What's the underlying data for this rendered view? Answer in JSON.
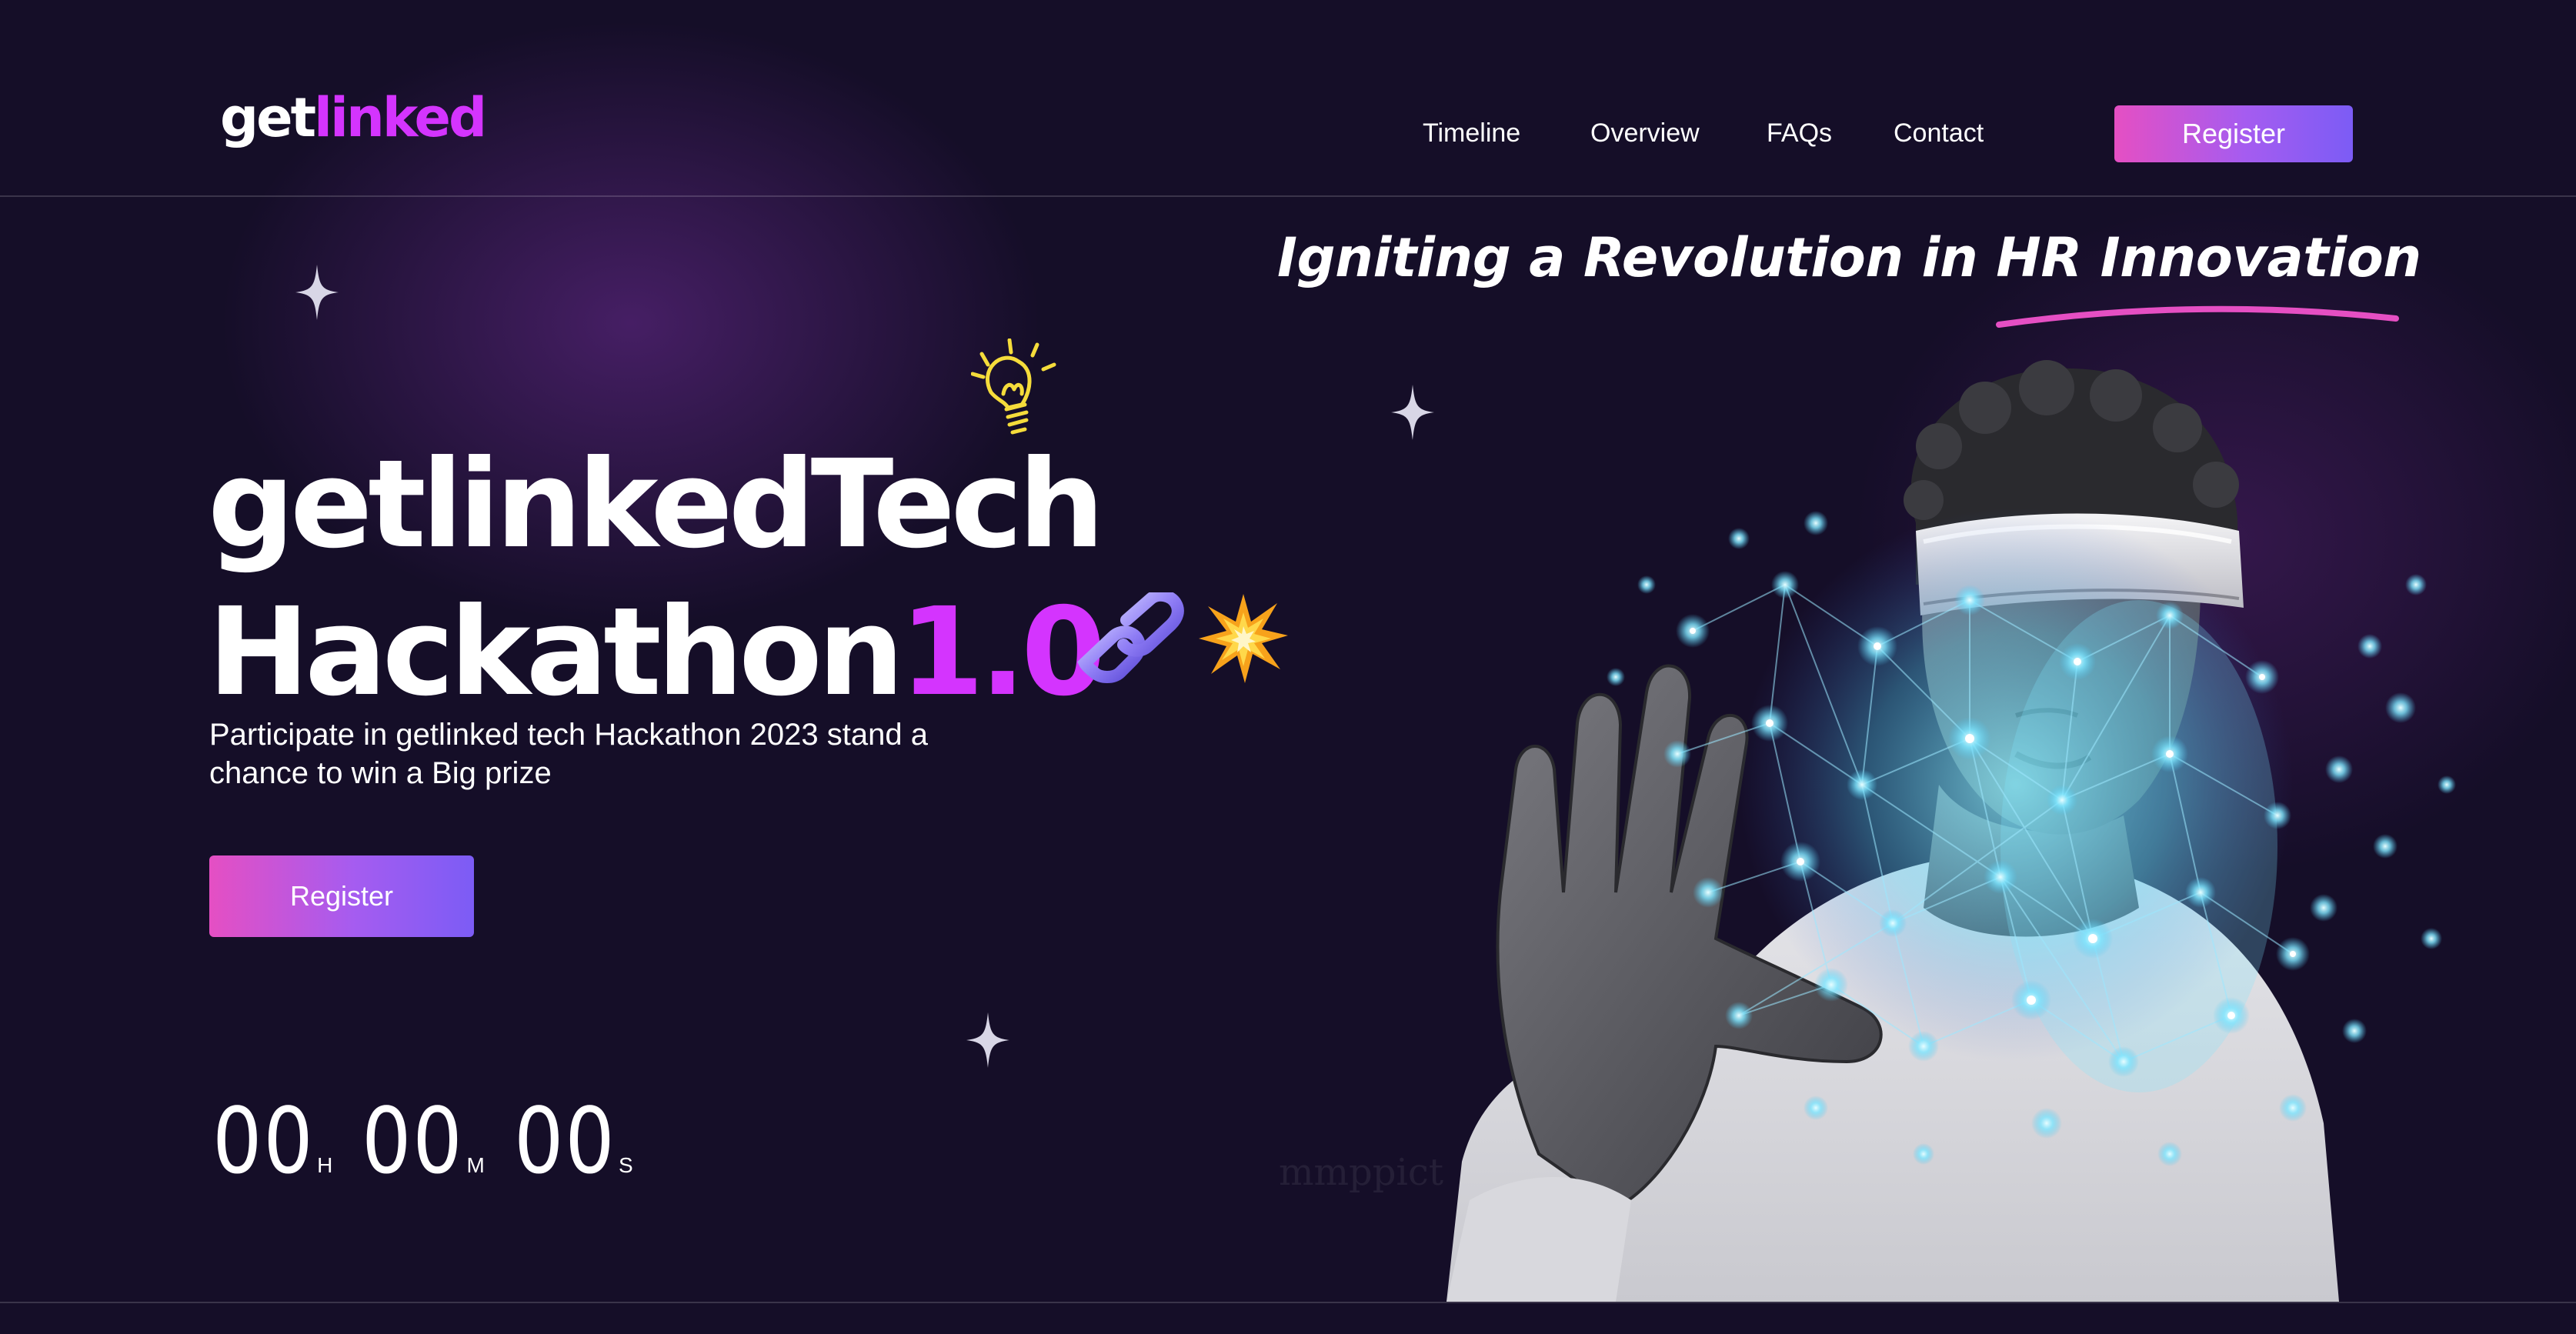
{
  "header": {
    "logo_prefix": "get",
    "logo_suffix": "linked",
    "nav": {
      "timeline": "Timeline",
      "overview": "Overview",
      "faqs": "FAQs",
      "contact": "Contact"
    },
    "register_label": "Register"
  },
  "hero": {
    "tagline": "Igniting a Revolution in HR Innovation",
    "title_line1": "getlinkedTech",
    "title_line2_prefix": "Hackathon",
    "title_line2_accent": "1.0",
    "description": "Participate in getlinked tech Hackathon 2023 stand a chance to win a Big prize",
    "register_label": "Register",
    "countdown": {
      "hours": "00",
      "hours_label": "H",
      "minutes": "00",
      "minutes_label": "M",
      "seconds": "00",
      "seconds_label": "S"
    },
    "watermark": "mmppict"
  },
  "icons": {
    "bulb": "lightbulb-icon",
    "chain": "chain-link-icon",
    "spark": "explosion-icon",
    "star": "sparkle-star-icon"
  },
  "colors": {
    "background": "#150e28",
    "accent_purple": "#d434fe",
    "gradient_start": "#e54fc3",
    "gradient_end": "#7c5cf5",
    "underline_pink": "#e54fc3"
  }
}
